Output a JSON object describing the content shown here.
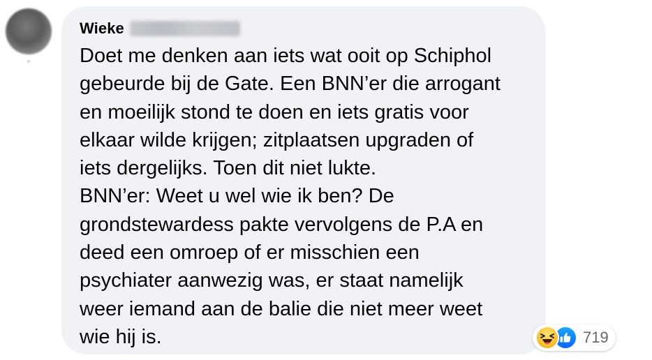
{
  "comment": {
    "author_first_name": "Wieke",
    "author_last_name_state": "blurred",
    "lines": [
      "Doet me denken aan iets wat ooit op Schiphol",
      "gebeurde bij de Gate. Een BNN’er die arrogant",
      "en moeilijk stond te doen en iets gratis voor",
      "elkaar wilde krijgen; zitplaatsen upgraden of",
      "iets dergelijks. Toen dit niet lukte.",
      "BNN’er: Weet u wel wie ik ben? De",
      "grondstewardess pakte vervolgens de P.A en",
      "deed een omroep of er misschien een",
      "psychiater aanwezig was, er staat namelijk",
      "weer iemand aan de balie die niet meer weet",
      "wie hij is."
    ]
  },
  "reactions": {
    "icons": [
      "haha-icon",
      "like-icon"
    ],
    "count": "719"
  },
  "colors": {
    "bubble_background": "#f0f2f5",
    "text": "#050505",
    "secondary_text": "#65676b",
    "like_blue": "#0866ff",
    "haha_yellow": "#fcc62d"
  }
}
